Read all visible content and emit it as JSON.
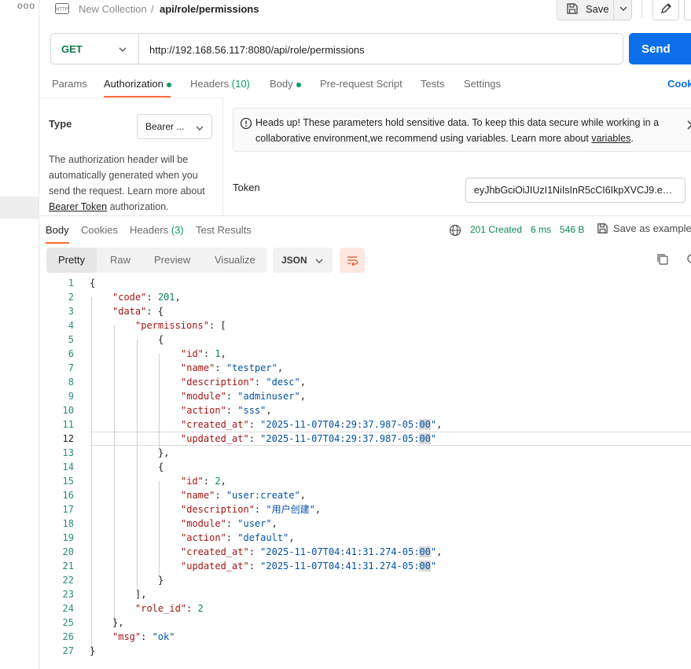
{
  "sidebar": {
    "more_label": "ooo"
  },
  "header": {
    "collection": "New Collection",
    "separator": "/",
    "request_name": "api/role/permissions",
    "save_label": "Save"
  },
  "request": {
    "method": "GET",
    "url": "http://192.168.56.117:8080/api/role/permissions",
    "send_label": "Send"
  },
  "tabs": [
    {
      "label": "Params"
    },
    {
      "label": "Authorization"
    },
    {
      "label": "Headers",
      "count": "(10)"
    },
    {
      "label": "Body"
    },
    {
      "label": "Pre-request Script"
    },
    {
      "label": "Tests"
    },
    {
      "label": "Settings"
    }
  ],
  "cookies_label": "Cook",
  "auth": {
    "type_label": "Type",
    "type_value": "Bearer ...",
    "desc_prefix": "The authorization header will be automatically generated when you send the request. Learn more about ",
    "desc_link": "Bearer Token",
    "desc_suffix": " authorization.",
    "notice_text": "Heads up! These parameters hold sensitive data. To keep this data secure while working in a collaborative environment,we recommend using variables. Learn more about ",
    "notice_link": "variables",
    "notice_end": ".",
    "token_label": "Token",
    "token_value": "eyJhbGciOiJIUzI1NiIsInR5cCI6IkpXVCJ9.eyJ..."
  },
  "response": {
    "tabs": [
      {
        "label": "Body"
      },
      {
        "label": "Cookies"
      },
      {
        "label": "Headers",
        "count": "(3)"
      },
      {
        "label": "Test Results"
      }
    ],
    "status": "201 Created",
    "time": "6 ms",
    "size": "546 B",
    "save_example": "Save as example",
    "view_tabs": [
      "Pretty",
      "Raw",
      "Preview",
      "Visualize"
    ],
    "format": "JSON"
  },
  "code_lines": [
    {
      "n": "1"
    },
    {
      "n": "2"
    },
    {
      "n": "3"
    },
    {
      "n": "4"
    },
    {
      "n": "5"
    },
    {
      "n": "6"
    },
    {
      "n": "7"
    },
    {
      "n": "8"
    },
    {
      "n": "9"
    },
    {
      "n": "10"
    },
    {
      "n": "11"
    },
    {
      "n": "12"
    },
    {
      "n": "13"
    },
    {
      "n": "14"
    },
    {
      "n": "15"
    },
    {
      "n": "16"
    },
    {
      "n": "17"
    },
    {
      "n": "18"
    },
    {
      "n": "19"
    },
    {
      "n": "20"
    },
    {
      "n": "21"
    },
    {
      "n": "22"
    },
    {
      "n": "23"
    },
    {
      "n": "24"
    },
    {
      "n": "25"
    },
    {
      "n": "26"
    },
    {
      "n": "27"
    }
  ],
  "json": {
    "k_code": "\"code\"",
    "v_code": "201",
    "k_data": "\"data\"",
    "k_permissions": "\"permissions\"",
    "k_id": "\"id\"",
    "k_name": "\"name\"",
    "k_description": "\"description\"",
    "k_module": "\"module\"",
    "k_action": "\"action\"",
    "k_created_at": "\"created_at\"",
    "k_updated_at": "\"updated_at\"",
    "p1": {
      "id": "1",
      "name": "\"testper\"",
      "description": "\"desc\"",
      "module": "\"adminuser\"",
      "action": "\"sss\"",
      "created_at": "\"2025-11-07T04:29:37.987-05:",
      "created_tail": "00",
      "updated_at": "\"2025-11-07T04:29:37.987-05:",
      "updated_tail": "00"
    },
    "p2": {
      "id": "2",
      "name": "\"user:create\"",
      "description": "\"用户创建\"",
      "module": "\"user\"",
      "action": "\"default\"",
      "created_at": "\"2025-11-07T04:41:31.274-05:",
      "created_tail": "00",
      "updated_at": "\"2025-11-07T04:41:31.274-05:",
      "updated_tail": "00"
    },
    "k_role_id": "\"role_id\"",
    "v_role_id": "2",
    "k_msg": "\"msg\"",
    "v_msg": "\"ok\""
  },
  "colors": {
    "accent": "#ff6c37",
    "send": "#0a6fe8",
    "status_green": "#0b8a50",
    "method_green": "#0b7a4a"
  }
}
